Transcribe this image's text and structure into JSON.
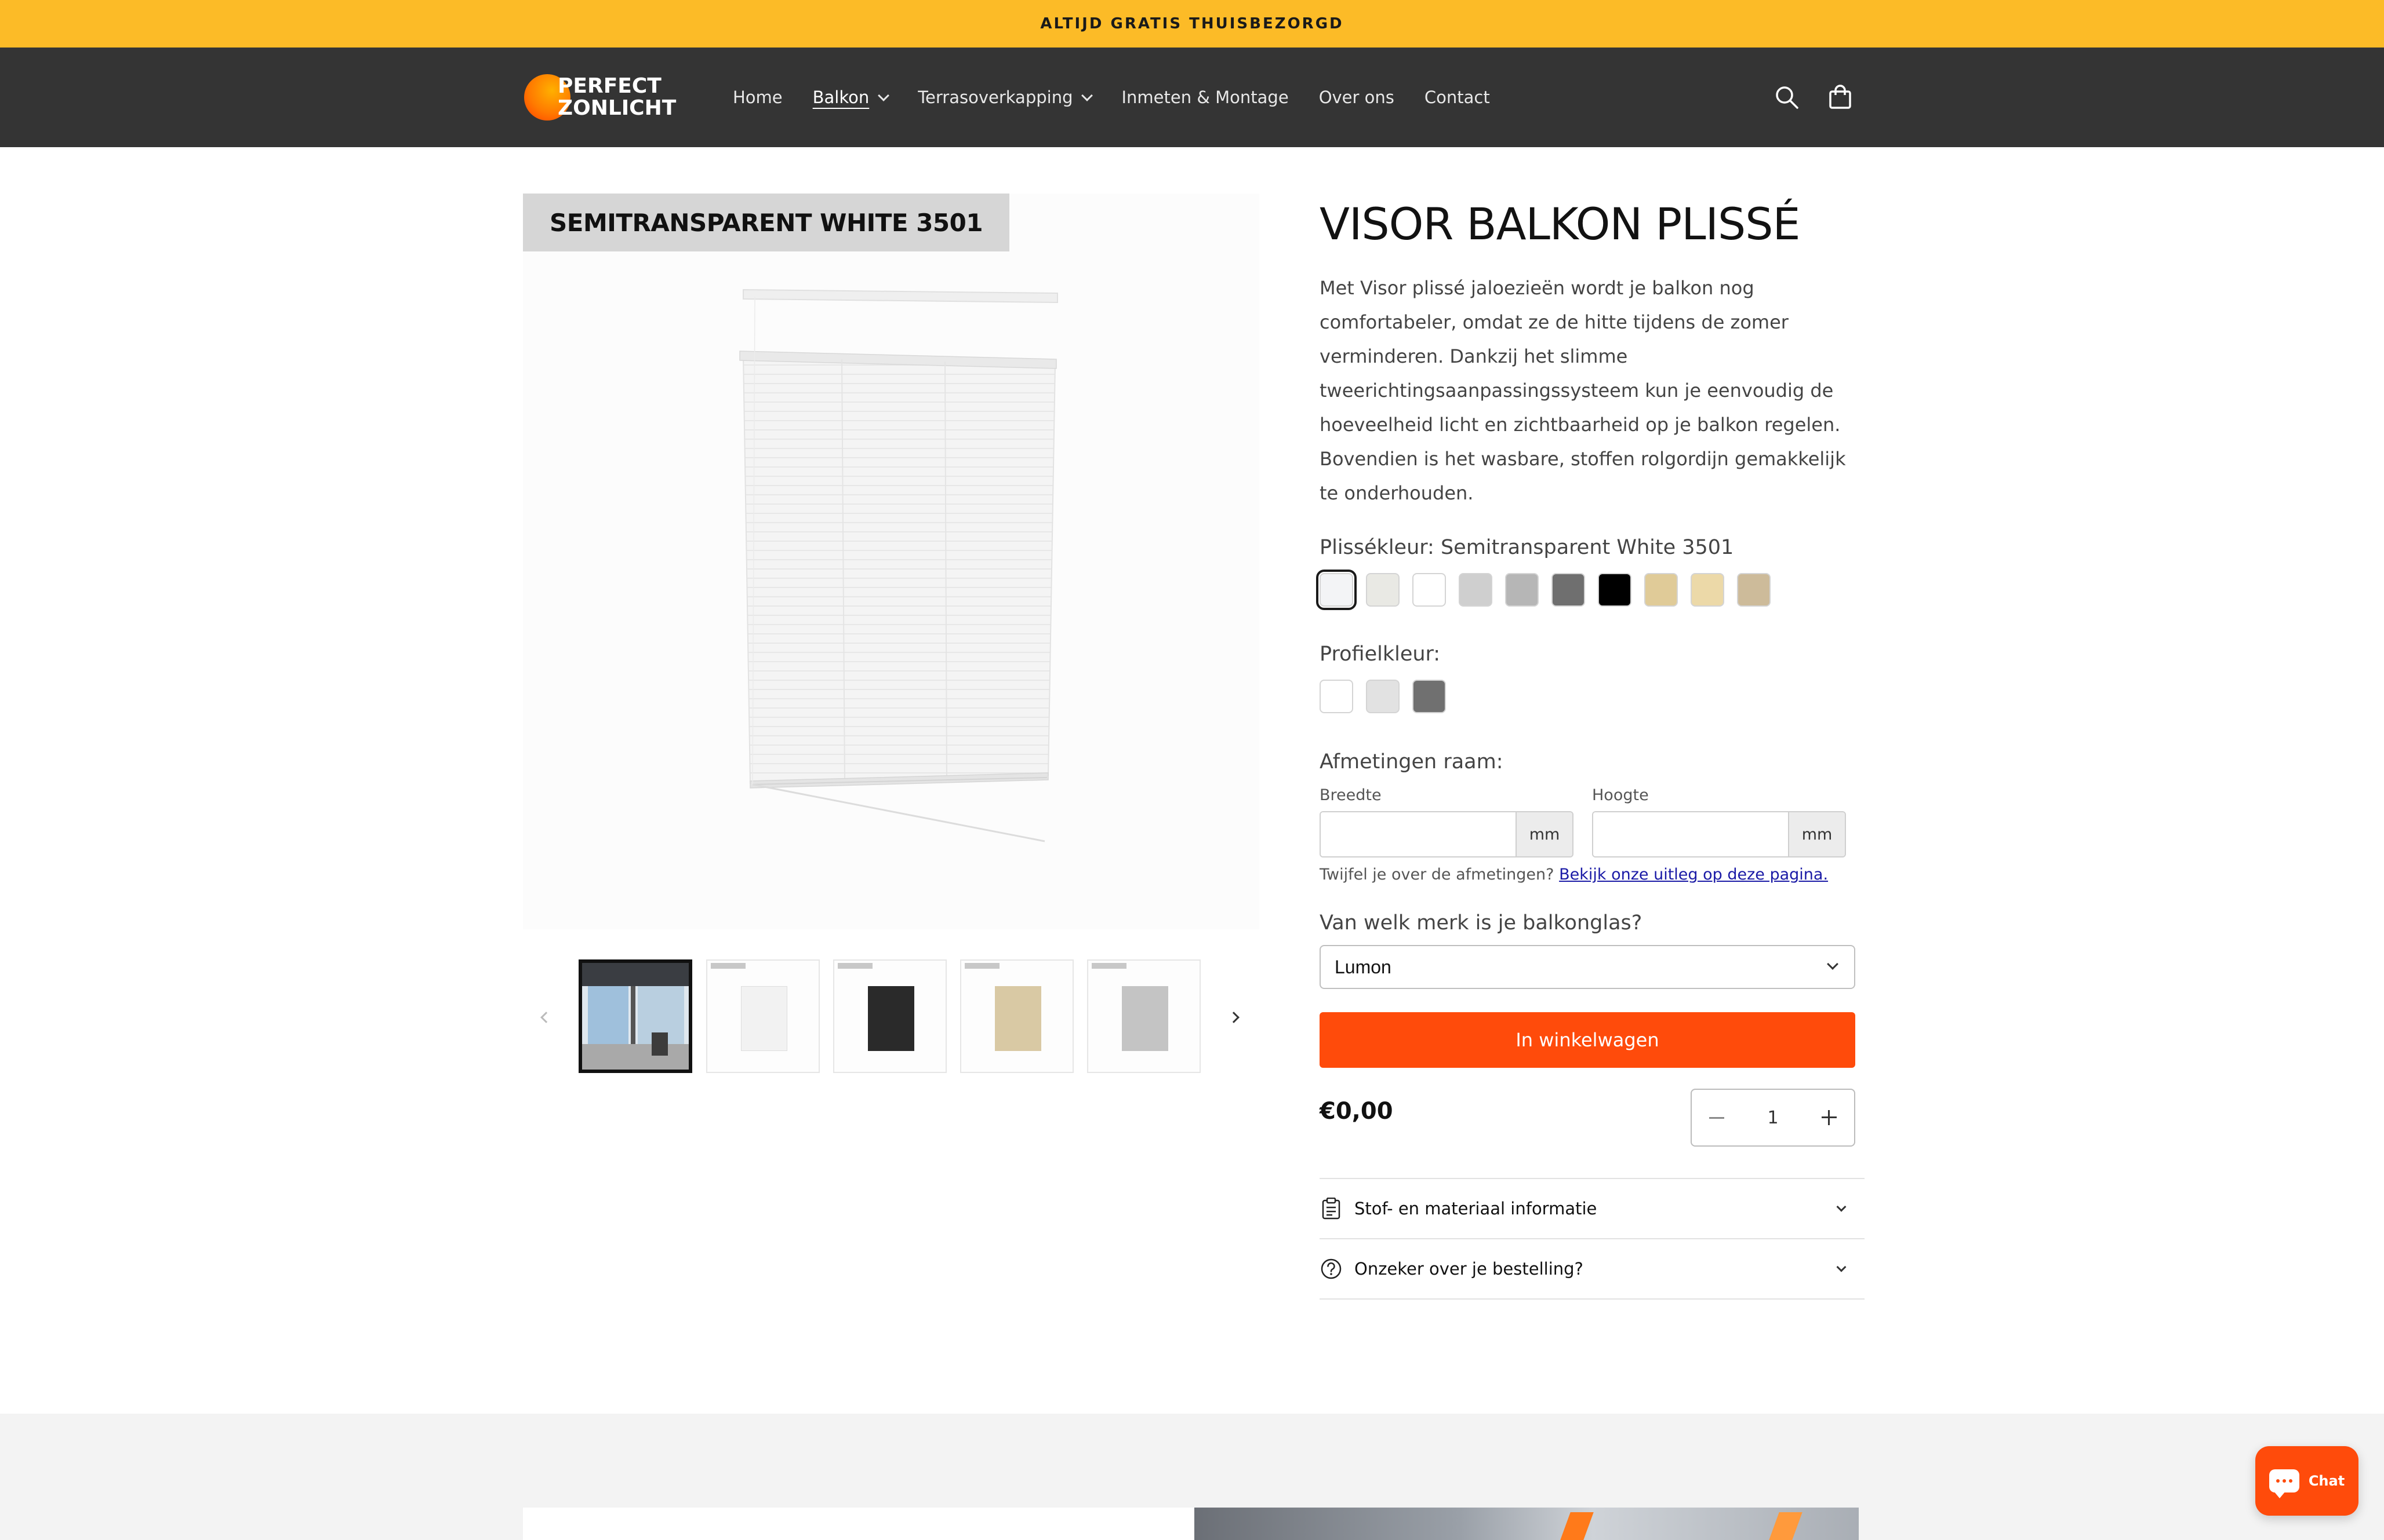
{
  "announcement": {
    "text": "ALTIJD GRATIS THUISBEZORGD"
  },
  "header": {
    "logo_line1": "PERFECT",
    "logo_line2": "ZONLICHT",
    "nav": [
      {
        "label": "Home",
        "has_dropdown": false,
        "active": false
      },
      {
        "label": "Balkon",
        "has_dropdown": true,
        "active": true
      },
      {
        "label": "Terrasoverkapping",
        "has_dropdown": true,
        "active": false
      },
      {
        "label": "Inmeten & Montage",
        "has_dropdown": false,
        "active": false
      },
      {
        "label": "Over ons",
        "has_dropdown": false,
        "active": false
      },
      {
        "label": "Contact",
        "has_dropdown": false,
        "active": false
      }
    ],
    "icons": [
      "search-icon",
      "cart-icon"
    ]
  },
  "gallery": {
    "variant_badge": "SEMITRANSPARENT WHITE 3501",
    "thumbnails": [
      {
        "name": "balcony-photo",
        "color": "#8aa9c4",
        "selected": true
      },
      {
        "name": "bright-white",
        "color": "#f2f2f2",
        "selected": false
      },
      {
        "name": "black",
        "color": "#2a2a2a",
        "selected": false
      },
      {
        "name": "beige",
        "color": "#d9c9a4",
        "selected": false
      },
      {
        "name": "light-grey",
        "color": "#c4c4c4",
        "selected": false
      }
    ]
  },
  "product": {
    "title": "VISOR BALKON PLISSÉ",
    "description": "Met Visor plissé jaloezieën wordt je balkon nog comfortabeler, omdat ze de hitte tijdens de zomer verminderen. Dankzij het slimme tweerichtingsaanpassingssysteem kun je eenvoudig de hoeveelheid licht en zichtbaarheid op je balkon regelen. Bovendien is het wasbare, stoffen rolgordijn gemakkelijk te onderhouden.",
    "pleat_color_label": "Plissékleur: Semitransparent White 3501",
    "pleat_colors": [
      "#f3f4f6",
      "#e9e9e4",
      "#ffffff",
      "#cfcfcf",
      "#b6b6b6",
      "#6f6f6f",
      "#000000",
      "#e0cb98",
      "#ecd9a8",
      "#cdbb9a"
    ],
    "profile_color_label": "Profielkleur:",
    "profile_colors": [
      "#ffffff",
      "#e2e2e2",
      "#707070"
    ],
    "dimensions_label": "Afmetingen raam:",
    "width_label": "Breedte",
    "height_label": "Hoogte",
    "unit": "mm",
    "hint_text": "Twijfel je over de afmetingen?",
    "hint_link": "Bekijk onze uitleg op deze pagina.",
    "brand_question": "Van welk merk is je balkonglas?",
    "brand_selected": "Lumon",
    "add_to_cart": "In winkelwagen",
    "price": "€0,00",
    "quantity": "1",
    "accordion": [
      {
        "label": "Stof- en materiaal informatie",
        "icon": "clipboard-icon"
      },
      {
        "label": "Onzeker over je bestelling?",
        "icon": "question-circle-icon"
      }
    ]
  },
  "chat": {
    "label": "Chat"
  },
  "colors": {
    "announcement": "#fcbb27",
    "header": "#343434",
    "accent": "#ff4b0b"
  }
}
